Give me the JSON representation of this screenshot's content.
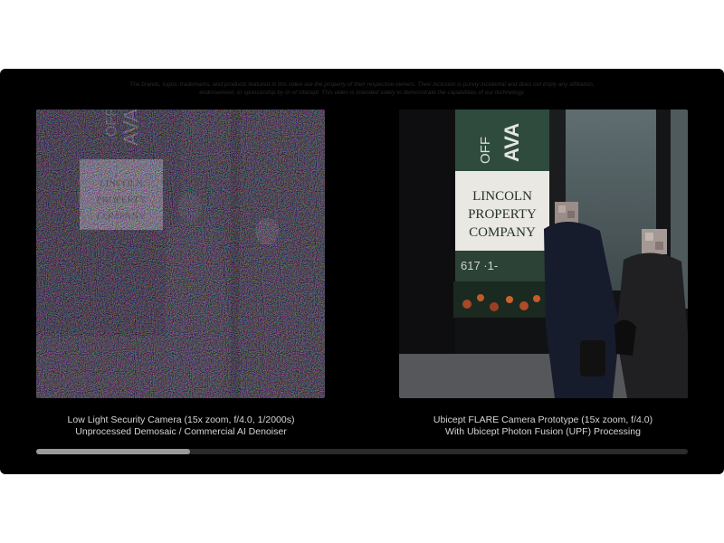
{
  "disclaimer": "The brands, logos, trademarks, and products featured in this video are the property of their respective owners. Their inclusion is purely incidental and does not imply any affiliation, endorsement, or sponsorship by or of Ubicept. This video is intended solely to demonstrate the capabilities of our technology.",
  "left_panel": {
    "caption_line1": "Low Light Security Camera (15x zoom, f/4.0, 1/2000s)",
    "caption_line2": "Unprocessed Demosaic / Commercial AI Denoiser"
  },
  "right_panel": {
    "caption_line1": "Ubicept FLARE Camera Prototype (15x zoom, f/4.0)",
    "caption_line2": "With Ubicept Photon Fusion (UPF) Processing"
  },
  "scene_sign": {
    "word1": "LINCOLN",
    "word2": "PROPERTY",
    "word3": "COMPANY",
    "top_text_a": "OFF",
    "top_text_b": "AVA",
    "phone": "617 ·1-"
  },
  "progress": {
    "fraction": 0.236
  },
  "colors": {
    "player_bg": "#000000",
    "progress_track": "#2b2b2b",
    "progress_fill": "#9a9a9a",
    "caption_text": "#d6d6d6"
  }
}
